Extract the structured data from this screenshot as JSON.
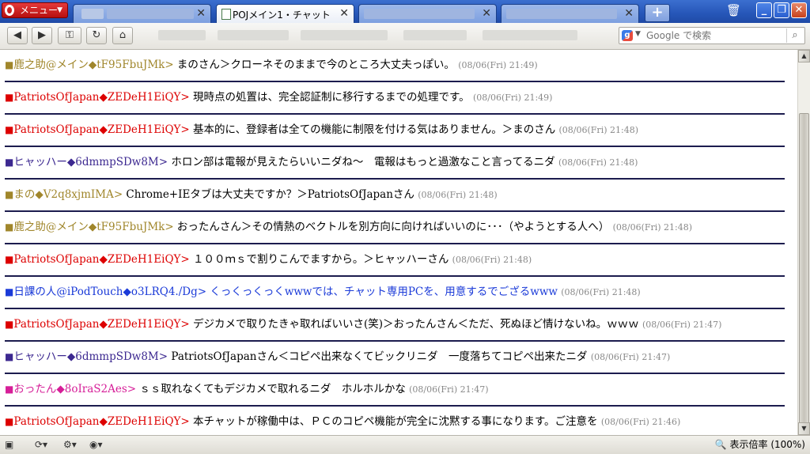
{
  "tabbar": {
    "menu_label": "メニュー",
    "active_tab_title": "POJメイン1・チャット",
    "new_tab_symbol": "+"
  },
  "window_controls": {
    "minimize": "_",
    "restore": "❐",
    "close": "✕"
  },
  "navbar": {
    "search_placeholder": "Google で検索"
  },
  "colors": {
    "gold": "#a0862b",
    "red": "#dd0000",
    "purple": "#3c2890",
    "blue": "#1a3ad8",
    "pink": "#d61e98",
    "separator": "#1c1c4e"
  },
  "messages": [
    {
      "marker": "■",
      "name": "鹿之助@メイン",
      "diamond": "◆",
      "trip": "tF95FbuJMk",
      "arrow": ">",
      "text": " まのさん＞クローネそのままで今のところ大丈夫っぽい。",
      "time": "(08/06(Fri) 21:49)",
      "name_color": "gold",
      "text_color": "black"
    },
    {
      "marker": "■",
      "name": "PatriotsOfJapan",
      "diamond": "◆",
      "trip": "ZEDeH1EiQY",
      "arrow": ">",
      "text": " 現時点の処置は、完全認証制に移行するまでの処理です。",
      "time": "(08/06(Fri) 21:49)",
      "name_color": "red",
      "text_color": "black"
    },
    {
      "marker": "■",
      "name": "PatriotsOfJapan",
      "diamond": "◆",
      "trip": "ZEDeH1EiQY",
      "arrow": ">",
      "text": " 基本的に、登録者は全ての機能に制限を付ける気はありません。＞まのさん",
      "time": "(08/06(Fri) 21:48)",
      "name_color": "red",
      "text_color": "black"
    },
    {
      "marker": "■",
      "name": "ヒャッハー",
      "diamond": "◆",
      "trip": "6dmmpSDw8M",
      "arrow": ">",
      "text": " ホロン部は電報が見えたらいいニダね～　電報はもっと過激なこと言ってるニダ",
      "time": "(08/06(Fri) 21:48)",
      "name_color": "purple",
      "text_color": "black"
    },
    {
      "marker": "■",
      "name": "まの",
      "diamond": "◆",
      "trip": "V2q8xjmIMA",
      "arrow": ">",
      "text": " Chrome+IEタブは大丈夫ですか？＞PatriotsOfJapanさん",
      "time": "(08/06(Fri) 21:48)",
      "name_color": "gold",
      "text_color": "black"
    },
    {
      "marker": "■",
      "name": "鹿之助@メイン",
      "diamond": "◆",
      "trip": "tF95FbuJMk",
      "arrow": ">",
      "text": " おったんさん＞その情熱のベクトルを別方向に向ければいいのに･･･（やようとする人へ）",
      "time": "(08/06(Fri) 21:48)",
      "name_color": "gold",
      "text_color": "black"
    },
    {
      "marker": "■",
      "name": "PatriotsOfJapan",
      "diamond": "◆",
      "trip": "ZEDeH1EiQY",
      "arrow": ">",
      "text": " １００ｍｓで割りこんでますから。＞ヒャッハーさん",
      "time": "(08/06(Fri) 21:48)",
      "name_color": "red",
      "text_color": "black"
    },
    {
      "marker": "■",
      "name": "日課の人@iPodTouch",
      "diamond": "◆",
      "trip": "o3LRQ4./Dg",
      "arrow": ">",
      "text": " くっくっくっくwwwでは、チャット専用PCを、用意するでござるwww",
      "time": "(08/06(Fri) 21:48)",
      "name_color": "blue",
      "text_color": "blue"
    },
    {
      "marker": "■",
      "name": "PatriotsOfJapan",
      "diamond": "◆",
      "trip": "ZEDeH1EiQY",
      "arrow": ">",
      "text": " デジカメで取りたきゃ取ればいいさ(笑)＞おったんさん＜ただ、死ぬほど情けないね。ｗｗｗ",
      "time": "(08/06(Fri) 21:47)",
      "name_color": "red",
      "text_color": "black"
    },
    {
      "marker": "■",
      "name": "ヒャッハー",
      "diamond": "◆",
      "trip": "6dmmpSDw8M",
      "arrow": ">",
      "text": " PatriotsOfJapanさん＜コピペ出来なくてビックリニダ　一度落ちてコピペ出来たニダ",
      "time": "(08/06(Fri) 21:47)",
      "name_color": "purple",
      "text_color": "black"
    },
    {
      "marker": "■",
      "name": "おったん",
      "diamond": "◆",
      "trip": "8oIraS2Aes",
      "arrow": ">",
      "text": " ｓｓ取れなくてもデジカメで取れるニダ　ホルホルかな",
      "time": "(08/06(Fri) 21:47)",
      "name_color": "pink",
      "text_color": "black"
    },
    {
      "marker": "■",
      "name": "PatriotsOfJapan",
      "diamond": "◆",
      "trip": "ZEDeH1EiQY",
      "arrow": ">",
      "text": " 本チャットが稼働中は、ＰＣのコピペ機能が完全に沈黙する事になります。ご注意を",
      "time": "(08/06(Fri) 21:46)",
      "name_color": "red",
      "text_color": "black"
    }
  ],
  "statusbar": {
    "zoom_label": "表示倍率 (100%)"
  }
}
